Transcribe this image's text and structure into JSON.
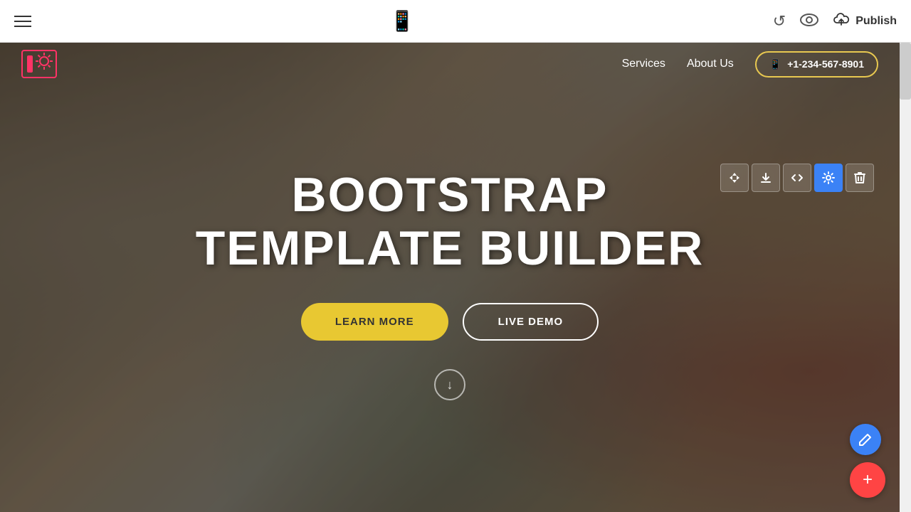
{
  "toolbar": {
    "publish_label": "Publish",
    "undo_icon": "↺",
    "eye_icon": "👁",
    "phone_icon": "📱",
    "cloud_icon": "☁"
  },
  "site": {
    "nav": {
      "services_label": "Services",
      "about_us_label": "About Us",
      "phone_number": "+1-234-567-8901"
    },
    "hero": {
      "title_line1": "BOOTSTRAP",
      "title_line2": "TEMPLATE BUILDER",
      "btn_learn_more": "LEARN MORE",
      "btn_live_demo": "LIVE DEMO"
    }
  },
  "section_tools": {
    "move": "⇅",
    "download": "⬇",
    "code": "</>",
    "settings": "⚙",
    "delete": "🗑"
  },
  "fab": {
    "edit_icon": "✏",
    "add_icon": "+"
  }
}
